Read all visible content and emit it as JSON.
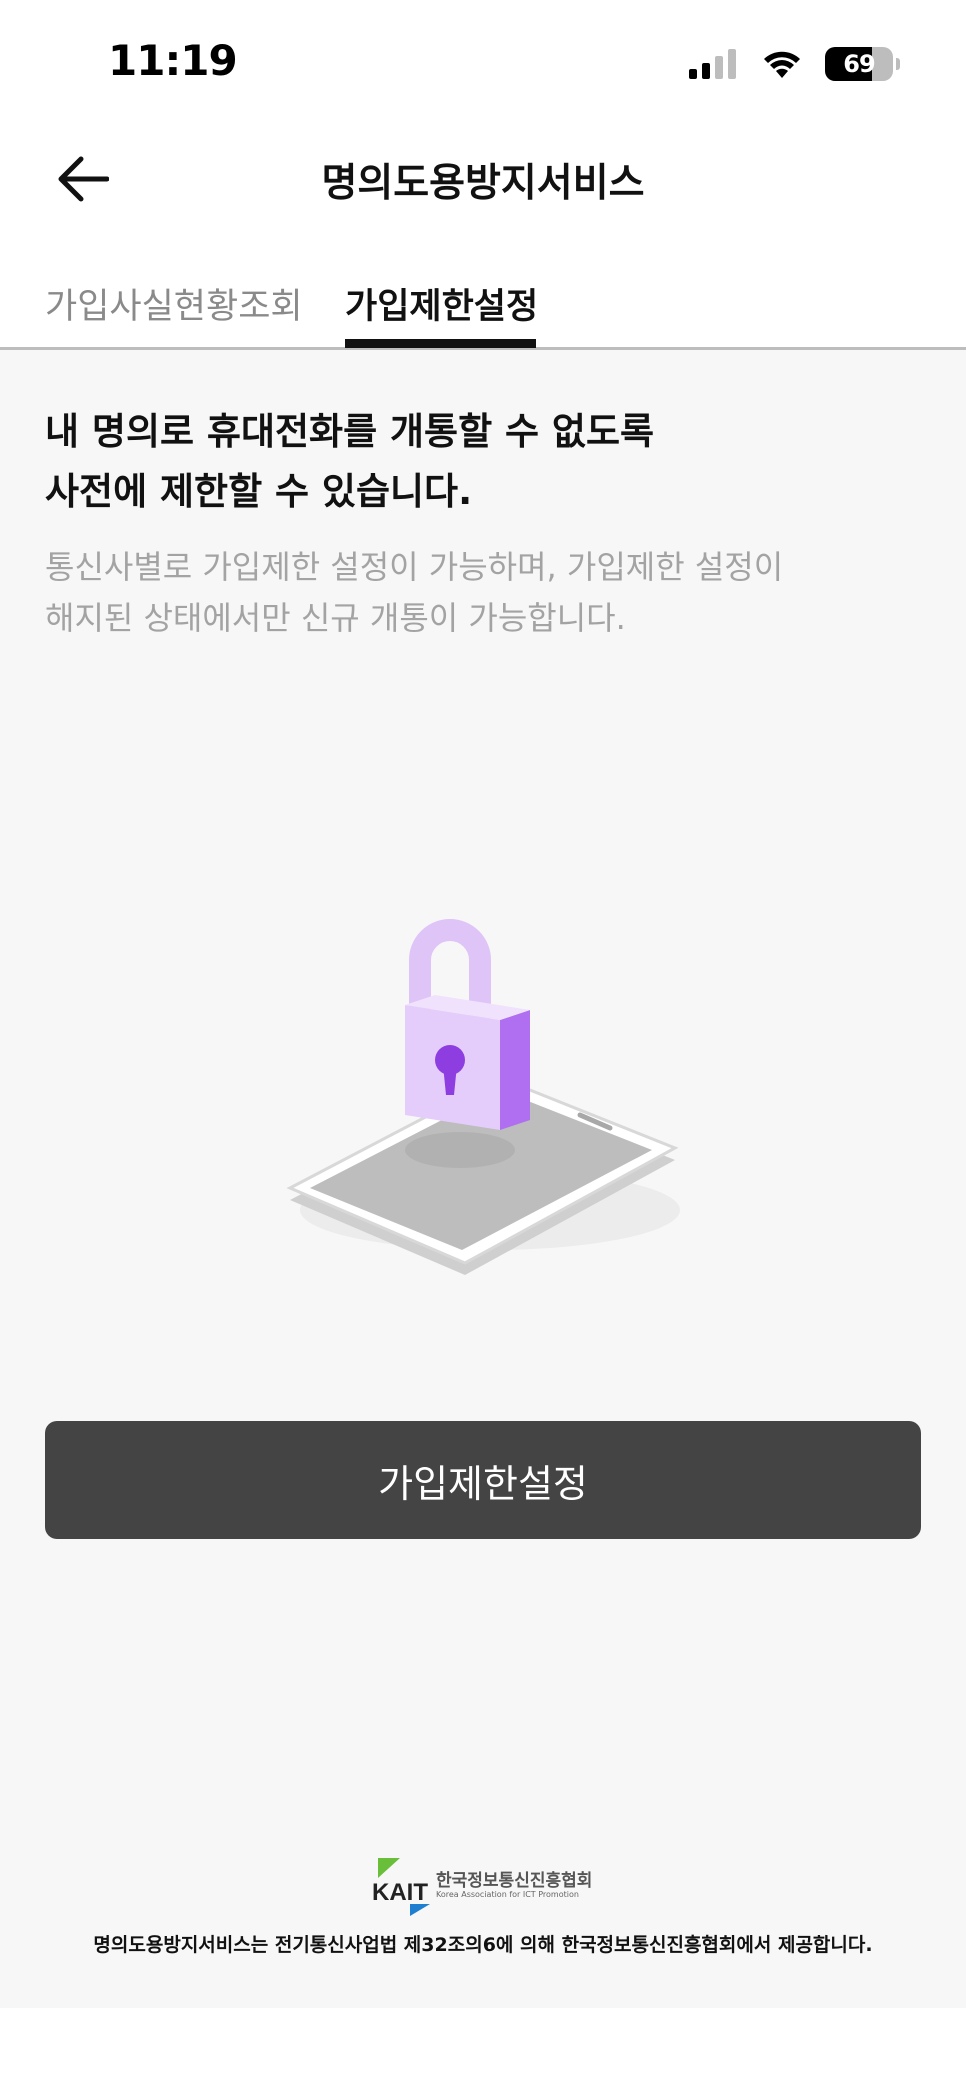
{
  "status_bar": {
    "time": "11:19",
    "battery_level": "69",
    "signal_bars": 2,
    "icons": [
      "cellular-signal-icon",
      "wifi-icon",
      "battery-icon"
    ]
  },
  "header": {
    "title": "명의도용방지서비스",
    "back_icon": "arrow-left-icon"
  },
  "tabs": [
    {
      "label": "가입사실현황조회",
      "active": false
    },
    {
      "label": "가입제한설정",
      "active": true
    }
  ],
  "main": {
    "headline_line1": "내 명의로 휴대전화를 개통할 수 없도록",
    "headline_line2": "사전에 제한할 수 있습니다.",
    "description_line1": "통신사별로 가입제한 설정이 가능하며, 가입제한 설정이",
    "description_line2": "해지된 상태에서만 신규 개통이 가능합니다.",
    "illustration": "phone-with-padlock-icon",
    "button_label": "가입제한설정"
  },
  "footer": {
    "logo_text": "KAIT",
    "org_name_kr": "한국정보통신진흥협회",
    "org_name_en": "Korea Association for ICT Promotion",
    "notice": "명의도용방지서비스는 전기통신사업법 제32조의6에 의해 한국정보통신진흥협회에서 제공합니다."
  },
  "colors": {
    "accent_purple": "#b06ef0",
    "button_bg": "#444444",
    "content_bg": "#f7f7f7",
    "muted_text": "#a3a3a3"
  }
}
